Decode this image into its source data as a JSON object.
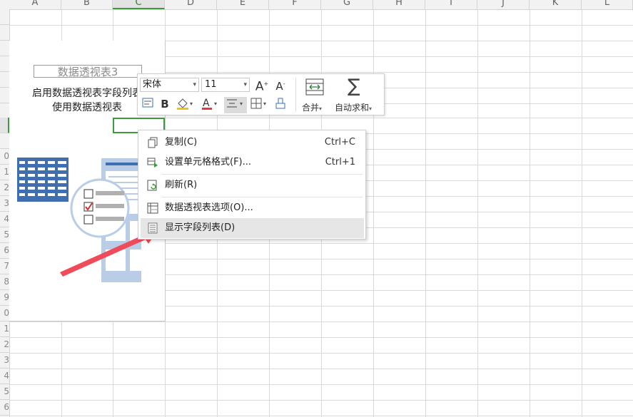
{
  "columns": [
    "A",
    "B",
    "C",
    "D",
    "E",
    "F",
    "G",
    "H",
    "I",
    "J",
    "K",
    "L"
  ],
  "selected_column": "C",
  "rows": [
    "",
    "",
    "",
    "",
    "",
    "",
    "",
    "",
    "",
    "0",
    "1",
    "2",
    "3",
    "4",
    "5",
    "6",
    "7",
    "8",
    "9",
    "0",
    "1",
    "2",
    "3",
    "4",
    "5",
    "6"
  ],
  "pivot": {
    "title": "数据透视表3",
    "hint_line1": "启用数据透视表字段列表",
    "hint_line2": "使用数据透视表"
  },
  "mini_toolbar": {
    "font_name": "宋体",
    "font_size": "11",
    "grow_font": "A",
    "shrink_font": "A",
    "bold": "B",
    "merge_label": "合并",
    "autosum_label": "自动求和",
    "font_color": "#e53935",
    "fill_color": "#f4c20d"
  },
  "context_menu": {
    "items": [
      {
        "label": "复制(C)",
        "shortcut": "Ctrl+C",
        "icon": "copy-icon"
      },
      {
        "label": "设置单元格格式(F)...",
        "shortcut": "Ctrl+1",
        "icon": "format-cells-icon"
      },
      {
        "label": "刷新(R)",
        "shortcut": "",
        "icon": "refresh-icon"
      },
      {
        "label": "数据透视表选项(O)...",
        "shortcut": "",
        "icon": "pivot-options-icon"
      },
      {
        "label": "显示字段列表(D)",
        "shortcut": "",
        "icon": "field-list-icon"
      }
    ],
    "highlighted_item": "显示字段列表(D)"
  },
  "colors": {
    "selection_green": "#3c9b3c",
    "arrow_red": "#f04b5a",
    "illustration_blue": "#3f6fb0"
  }
}
